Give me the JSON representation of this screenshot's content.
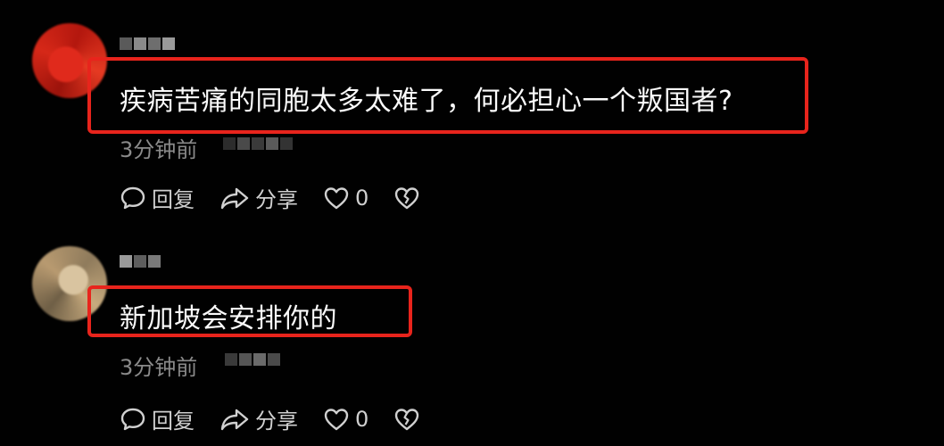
{
  "comments": [
    {
      "content": "疾病苦痛的同胞太多太难了，何必担心一个叛国者?",
      "time": "3分钟前",
      "reply_label": "回复",
      "share_label": "分享",
      "like_count": "0",
      "avatar_icon": "user-avatar-red",
      "highlight_color": "#e8241c"
    },
    {
      "content": "新加坡会安排你的",
      "time": "3分钟前",
      "reply_label": "回复",
      "share_label": "分享",
      "like_count": "0",
      "avatar_icon": "user-avatar-beige",
      "highlight_color": "#e8241c"
    }
  ],
  "icons": {
    "reply": "comment-bubble-icon",
    "share": "share-arrow-icon",
    "like": "heart-icon",
    "dislike": "broken-heart-icon"
  }
}
